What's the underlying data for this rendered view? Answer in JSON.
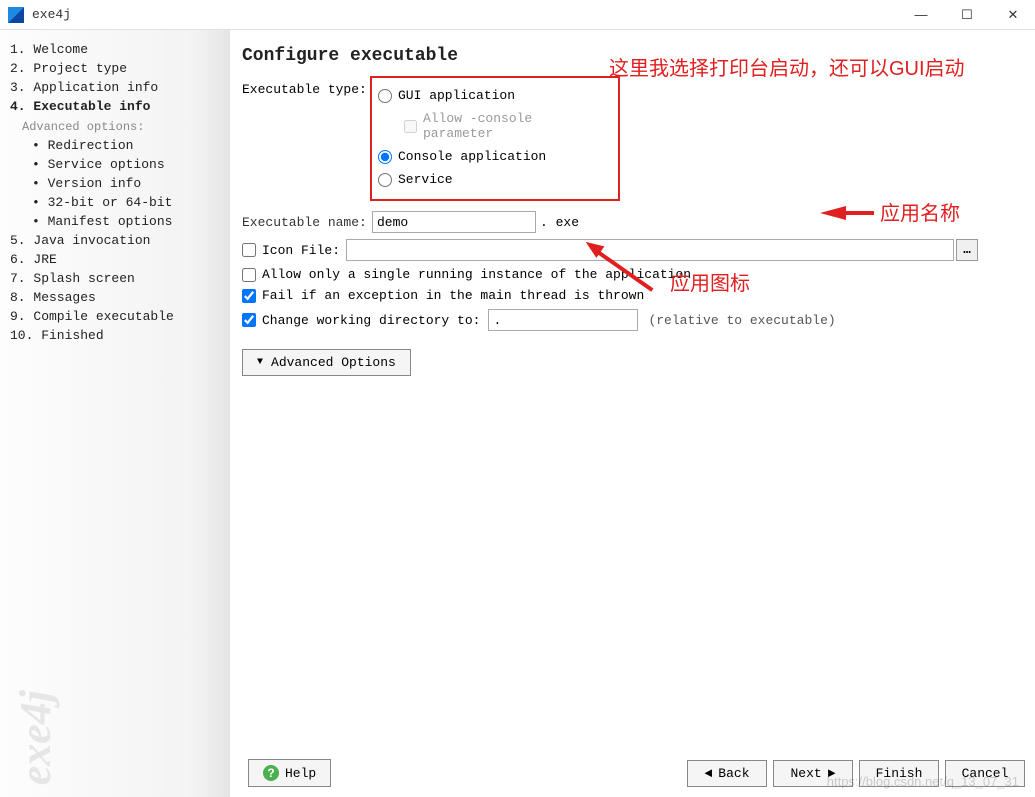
{
  "window": {
    "title": "exe4j",
    "min_tooltip": "Minimize",
    "max_tooltip": "Maximize",
    "close_tooltip": "Close"
  },
  "sidebar": {
    "steps": [
      "1. Welcome",
      "2. Project type",
      "3. Application info",
      "4. Executable info",
      "5. Java invocation",
      "6. JRE",
      "7. Splash screen",
      "8. Messages",
      "9. Compile executable",
      "10. Finished"
    ],
    "active_index": 3,
    "adv_header": "Advanced options:",
    "adv_items": [
      "Redirection",
      "Service options",
      "Version info",
      "32-bit or 64-bit",
      "Manifest options"
    ],
    "logo_text": "exe4j"
  },
  "main": {
    "title": "Configure executable",
    "exe_type_label": "Executable type:",
    "radios": {
      "gui": "GUI application",
      "allow_console": "Allow -console parameter",
      "console": "Console application",
      "service": "Service",
      "selected": "console"
    },
    "exe_name_label": "Executable name:",
    "exe_name_value": "demo",
    "exe_ext": ". exe",
    "icon_file_label": "Icon File:",
    "icon_file_value": "",
    "icon_browse": "…",
    "allow_single_label": "Allow only a single running instance of the application",
    "fail_exc_label": "Fail if an exception in the main thread is thrown",
    "cwd_label": "Change working directory to:",
    "cwd_value": ".",
    "cwd_hint": "(relative to executable)",
    "checked": {
      "icon": false,
      "single": false,
      "fail": true,
      "cwd": true
    },
    "adv_button": "Advanced Options"
  },
  "footer": {
    "help": "Help",
    "back": "Back",
    "next": "Next",
    "finish": "Finish",
    "cancel": "Cancel"
  },
  "annotations": {
    "a1": "这里我选择打印台启动，还可以GUI启动",
    "a2": "应用名称",
    "a3": "应用图标"
  },
  "watermark": "https://blog.csdn.net/q_13_07_31"
}
